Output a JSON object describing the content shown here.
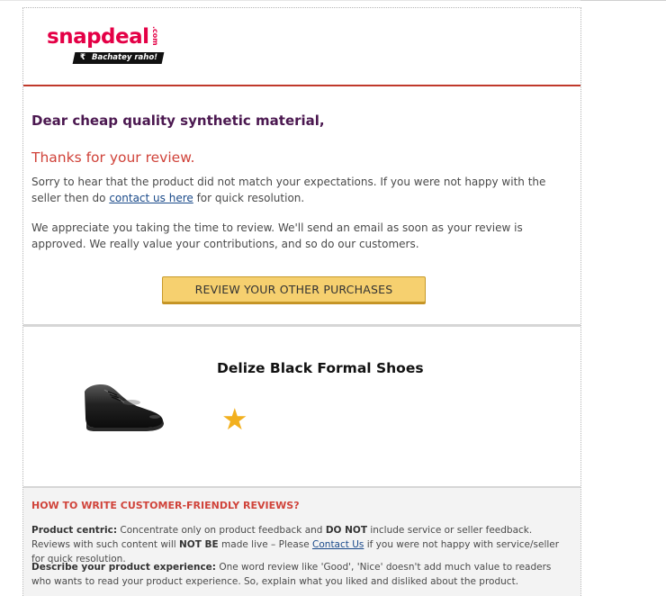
{
  "brand": {
    "logo_text": "snapdeal",
    "logo_suffix": ".com",
    "tagline": "Bachatey raho!",
    "rupee": "₹"
  },
  "message": {
    "greeting": "Dear cheap quality synthetic material,",
    "thanks": "Thanks for your review.",
    "para1_before": "Sorry to hear that the product did not match your expectations. If you were not happy with the seller then do ",
    "para1_link": "contact us here",
    "para1_after": " for quick resolution.",
    "para2": "We appreciate you taking the time to review. We'll send an email as soon as your review is approved. We really value your contributions, and so do our customers.",
    "cta_label": "REVIEW YOUR OTHER PURCHASES"
  },
  "product": {
    "name": "Delize Black Formal Shoes",
    "rating_stars": 1,
    "star_glyph": "★"
  },
  "tips": {
    "title": "HOW TO WRITE CUSTOMER-FRIENDLY REVIEWS?",
    "tip1_label": "Product centric:",
    "tip1_a": " Concentrate only on product feedback and ",
    "tip1_b": "DO NOT",
    "tip1_c": " include service or seller feedback. Reviews with such content will ",
    "tip1_d": "NOT BE",
    "tip1_e": " made live – Please ",
    "tip1_link": "Contact Us",
    "tip1_f": " if you were not happy with service/seller for quick resolution.",
    "tip2_label": "Describe your product experience:",
    "tip2_text": " One word review like 'Good', 'Nice' doesn't add much value to readers who wants to read your product experience. So, explain what you liked and disliked about the product."
  },
  "colors": {
    "brand_red": "#e40046",
    "header_rule": "#c0392b",
    "greeting": "#4b1850",
    "thanks": "#d0433a",
    "cta_bg": "#f6d06f",
    "star": "#f2b01e"
  }
}
